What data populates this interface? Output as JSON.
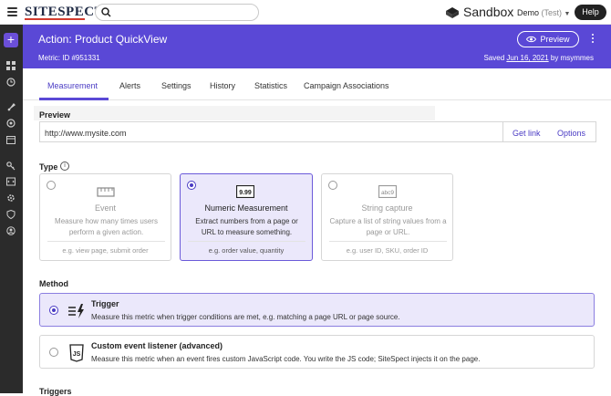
{
  "topbar": {
    "logo": "SITESPECT",
    "search_placeholder": "",
    "sandbox_label": "Sandbox",
    "account": "Demo",
    "account_env": "(Test)",
    "help": "Help"
  },
  "header": {
    "title": "Action: Product QuickView",
    "metric_id": "Metric: ID #951331",
    "preview_button": "Preview",
    "saved_prefix": "Saved",
    "saved_date": "Jun 16, 2021",
    "saved_by": "by msymmes"
  },
  "tabs": [
    {
      "label": "Measurement",
      "active": true
    },
    {
      "label": "Alerts"
    },
    {
      "label": "Settings"
    },
    {
      "label": "History"
    },
    {
      "label": "Statistics"
    },
    {
      "label": "Campaign Associations"
    }
  ],
  "preview": {
    "label": "Preview",
    "url": "http://www.mysite.com",
    "get_link": "Get link",
    "options": "Options"
  },
  "type": {
    "label": "Type",
    "cards": [
      {
        "title": "Event",
        "desc": "Measure how many times users perform a given action.",
        "example": "e.g. view page, submit order",
        "selected": false
      },
      {
        "title": "Numeric Measurement",
        "desc": "Extract numbers from a page or URL to measure something.",
        "example": "e.g. order value, quantity",
        "icon_text": "9.99",
        "selected": true
      },
      {
        "title": "String capture",
        "desc": "Capture a list of string values from a page or URL.",
        "example": "e.g. user ID, SKU, order ID",
        "icon_text": "abc9",
        "selected": false
      }
    ]
  },
  "method": {
    "label": "Method",
    "options": [
      {
        "title": "Trigger",
        "desc": "Measure this metric when trigger conditions are met, e.g. matching a page URL or page source.",
        "selected": true
      },
      {
        "title": "Custom event listener (advanced)",
        "desc": "Measure this metric when an event fires custom JavaScript code. You write the JS code; SiteSpect injects it on the page.",
        "icon_text": "JS",
        "selected": false
      }
    ]
  },
  "triggers_label": "Triggers",
  "colors": {
    "accent": "#5a48d6",
    "link": "#4a3bc4",
    "sidenav": "#2b2b2b"
  }
}
